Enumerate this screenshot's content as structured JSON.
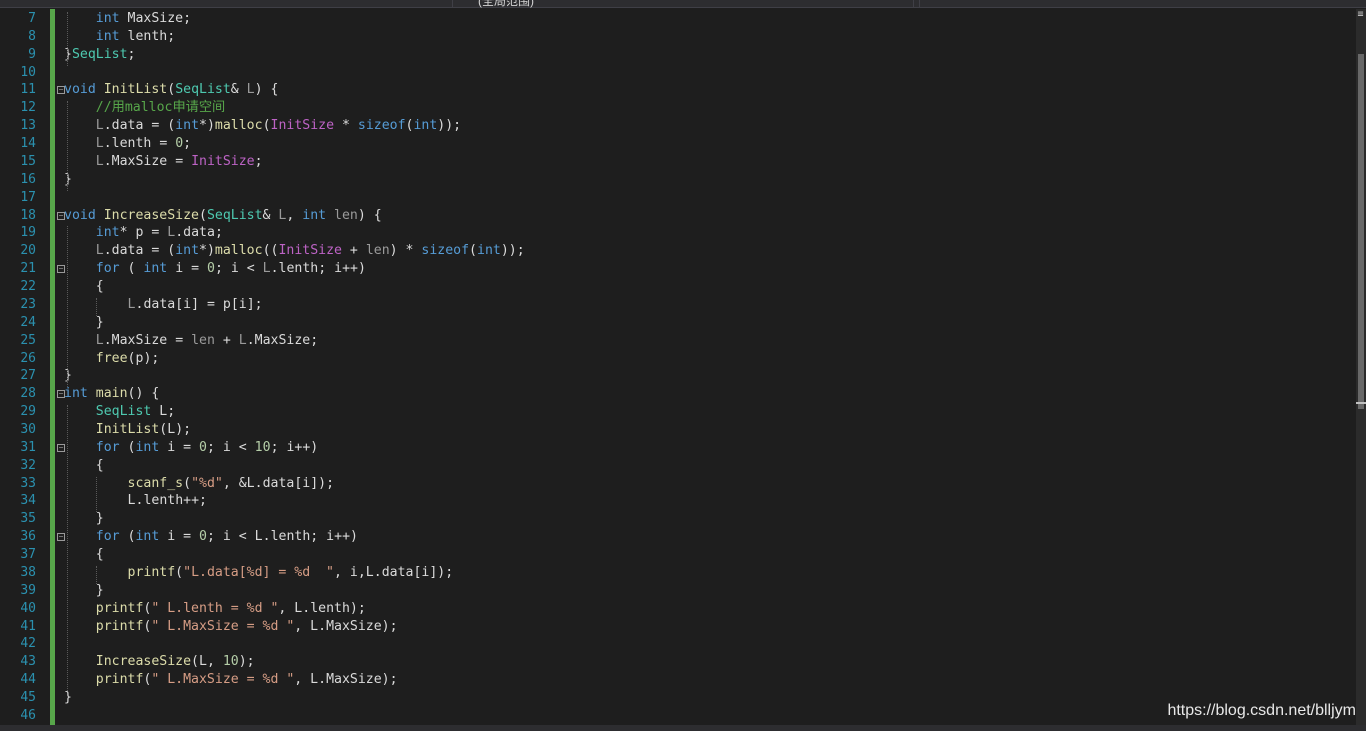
{
  "topbar": {
    "tab_fragment": "(全局范围)"
  },
  "editor": {
    "lines": [
      {
        "n": "7",
        "fold": false,
        "html": "    <span class=\"kw\">int</span> <span class=\"mem\">MaxSize</span>;"
      },
      {
        "n": "8",
        "fold": false,
        "html": "    <span class=\"kw\">int</span> <span class=\"mem\">lenth</span>;"
      },
      {
        "n": "9",
        "fold": false,
        "html": "}<span class=\"ty\">SeqList</span>;"
      },
      {
        "n": "10",
        "fold": false,
        "html": ""
      },
      {
        "n": "11",
        "fold": true,
        "html": "<span class=\"kw\">void</span> <span class=\"fn\">InitList</span>(<span class=\"ty\">SeqList</span>&amp; <span class=\"pm\">L</span>) {"
      },
      {
        "n": "12",
        "fold": false,
        "html": "    <span class=\"cm\">//用malloc申请空间</span>"
      },
      {
        "n": "13",
        "fold": false,
        "html": "    <span class=\"pm\">L</span>.<span class=\"mem\">data</span> = (<span class=\"kw\">int</span>*)<span class=\"fn\">malloc</span>(<span class=\"mac\">InitSize</span> * <span class=\"kw\">sizeof</span>(<span class=\"kw\">int</span>));"
      },
      {
        "n": "14",
        "fold": false,
        "html": "    <span class=\"pm\">L</span>.<span class=\"mem\">lenth</span> = <span class=\"num\">0</span>;"
      },
      {
        "n": "15",
        "fold": false,
        "html": "    <span class=\"pm\">L</span>.<span class=\"mem\">MaxSize</span> = <span class=\"mac\">InitSize</span>;"
      },
      {
        "n": "16",
        "fold": false,
        "html": "}"
      },
      {
        "n": "17",
        "fold": false,
        "html": ""
      },
      {
        "n": "18",
        "fold": true,
        "html": "<span class=\"kw\">void</span> <span class=\"fn\">IncreaseSize</span>(<span class=\"ty\">SeqList</span>&amp; <span class=\"pm\">L</span>, <span class=\"kw\">int</span> <span class=\"pm\">len</span>) {"
      },
      {
        "n": "19",
        "fold": false,
        "html": "    <span class=\"kw\">int</span>* <span class=\"mem\">p</span> = <span class=\"pm\">L</span>.<span class=\"mem\">data</span>;"
      },
      {
        "n": "20",
        "fold": false,
        "html": "    <span class=\"pm\">L</span>.<span class=\"mem\">data</span> = (<span class=\"kw\">int</span>*)<span class=\"fn\">malloc</span>((<span class=\"mac\">InitSize</span> + <span class=\"pm\">len</span>) * <span class=\"kw\">sizeof</span>(<span class=\"kw\">int</span>));"
      },
      {
        "n": "21",
        "fold": true,
        "html": "    <span class=\"kw\">for</span> ( <span class=\"kw\">int</span> <span class=\"mem\">i</span> = <span class=\"num\">0</span>; <span class=\"mem\">i</span> &lt; <span class=\"pm\">L</span>.<span class=\"mem\">lenth</span>; <span class=\"mem\">i</span>++)"
      },
      {
        "n": "22",
        "fold": false,
        "html": "    {"
      },
      {
        "n": "23",
        "fold": false,
        "html": "        <span class=\"pm\">L</span>.<span class=\"mem\">data</span>[<span class=\"mem\">i</span>] = <span class=\"mem\">p</span>[<span class=\"mem\">i</span>];"
      },
      {
        "n": "24",
        "fold": false,
        "html": "    }"
      },
      {
        "n": "25",
        "fold": false,
        "html": "    <span class=\"pm\">L</span>.<span class=\"mem\">MaxSize</span> = <span class=\"pm\">len</span> + <span class=\"pm\">L</span>.<span class=\"mem\">MaxSize</span>;"
      },
      {
        "n": "26",
        "fold": false,
        "html": "    <span class=\"fn\">free</span>(<span class=\"mem\">p</span>);"
      },
      {
        "n": "27",
        "fold": false,
        "html": "}"
      },
      {
        "n": "28",
        "fold": true,
        "html": "<span class=\"kw\">int</span> <span class=\"fn\">main</span>() {"
      },
      {
        "n": "29",
        "fold": false,
        "html": "    <span class=\"ty\">SeqList</span> <span class=\"mem\">L</span>;"
      },
      {
        "n": "30",
        "fold": false,
        "html": "    <span class=\"fn\">InitList</span>(<span class=\"mem\">L</span>);"
      },
      {
        "n": "31",
        "fold": true,
        "html": "    <span class=\"kw\">for</span> (<span class=\"kw\">int</span> <span class=\"mem\">i</span> = <span class=\"num\">0</span>; <span class=\"mem\">i</span> &lt; <span class=\"num\">10</span>; <span class=\"mem\">i</span>++)"
      },
      {
        "n": "32",
        "fold": false,
        "html": "    {"
      },
      {
        "n": "33",
        "fold": false,
        "html": "        <span class=\"fn\">scanf_s</span>(<span class=\"str\">\"%d\"</span>, &amp;<span class=\"mem\">L</span>.<span class=\"mem\">data</span>[<span class=\"mem\">i</span>]);"
      },
      {
        "n": "34",
        "fold": false,
        "html": "        <span class=\"mem\">L</span>.<span class=\"mem\">lenth</span>++;"
      },
      {
        "n": "35",
        "fold": false,
        "html": "    }"
      },
      {
        "n": "36",
        "fold": true,
        "html": "    <span class=\"kw\">for</span> (<span class=\"kw\">int</span> <span class=\"mem\">i</span> = <span class=\"num\">0</span>; <span class=\"mem\">i</span> &lt; <span class=\"mem\">L</span>.<span class=\"mem\">lenth</span>; <span class=\"mem\">i</span>++)"
      },
      {
        "n": "37",
        "fold": false,
        "html": "    {"
      },
      {
        "n": "38",
        "fold": false,
        "html": "        <span class=\"fn\">printf</span>(<span class=\"str\">\"L.data[%d] = %d  \"</span>, <span class=\"mem\">i</span>,<span class=\"mem\">L</span>.<span class=\"mem\">data</span>[<span class=\"mem\">i</span>]);"
      },
      {
        "n": "39",
        "fold": false,
        "html": "    }"
      },
      {
        "n": "40",
        "fold": false,
        "html": "    <span class=\"fn\">printf</span>(<span class=\"str\">\" L.lenth = %d \"</span>, <span class=\"mem\">L</span>.<span class=\"mem\">lenth</span>);"
      },
      {
        "n": "41",
        "fold": false,
        "html": "    <span class=\"fn\">printf</span>(<span class=\"str\">\" L.MaxSize = %d \"</span>, <span class=\"mem\">L</span>.<span class=\"mem\">MaxSize</span>);"
      },
      {
        "n": "42",
        "fold": false,
        "html": ""
      },
      {
        "n": "43",
        "fold": false,
        "html": "    <span class=\"fn\">IncreaseSize</span>(<span class=\"mem\">L</span>, <span class=\"num\">10</span>);"
      },
      {
        "n": "44",
        "fold": false,
        "html": "    <span class=\"fn\">printf</span>(<span class=\"str\">\" L.MaxSize = %d \"</span>, <span class=\"mem\">L</span>.<span class=\"mem\">MaxSize</span>);"
      },
      {
        "n": "45",
        "fold": false,
        "html": "}"
      },
      {
        "n": "46",
        "fold": false,
        "html": ""
      }
    ]
  },
  "watermark": "https://blog.csdn.net/blljym"
}
